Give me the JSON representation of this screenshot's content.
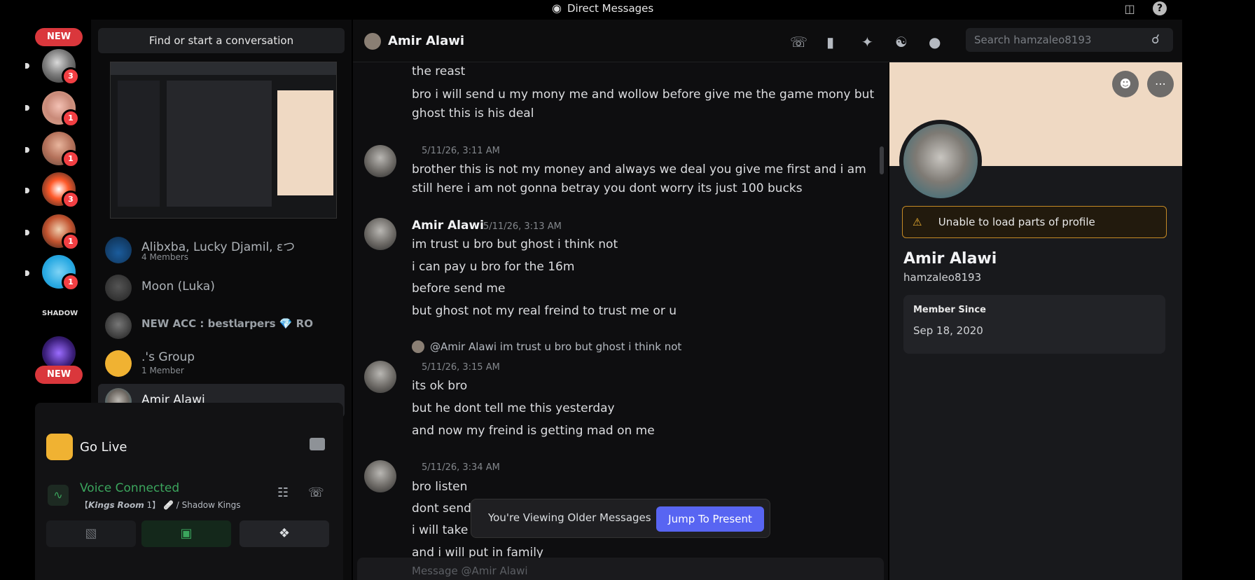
{
  "window": {
    "title": "Direct Messages"
  },
  "rail": {
    "new_top": "NEW",
    "new_bottom": "NEW",
    "badges": [
      "3",
      "1",
      "1",
      "3",
      "1",
      "1"
    ]
  },
  "dm": {
    "search_button": "Find or start a conversation",
    "items": [
      {
        "name": "Alibxba, Lucky Djamil, εつ",
        "sub": "4 Members"
      },
      {
        "name": "Moon (Luka)"
      },
      {
        "name": "𝗡𝗘𝗪 𝗔𝗖𝗖 : 𝗯𝗲𝘀𝘁𝗹𝗮𝗿𝗽𝗲𝗿𝘀 💎 RO"
      },
      {
        "name": ".'s Group",
        "sub": "1 Member"
      },
      {
        "name": "Amir Alawi"
      }
    ]
  },
  "panel": {
    "go_live": "Go Live",
    "voice_status": "Voice Connected",
    "voice_channel": "【𝙆𝙞𝙣𝙜𝙨 𝙍𝙤𝙤𝙢 1】 🩹 / Shadow Kings"
  },
  "chat": {
    "header_name": "Amir Alawi",
    "search_placeholder": "Search hamzaleo8193",
    "messages": {
      "m0": "the reast",
      "m1a": "bro i will send u my mony me and wollow before give me the game mony but",
      "m1b": "ghost this is his deal",
      "t2": "5/11/26, 3:11 AM",
      "m2a": "brother this is not my money and always we deal you give me first and i am",
      "m2b": "still here i am not gonna betray you dont worry its just 100 bucks",
      "a3": "Amir Alawi",
      "t3": "5/11/26, 3:13 AM",
      "m3a": "im trust u bro but ghost i think not",
      "m3b": "i can pay u bro for the 16m",
      "m3c": "before send me",
      "m3d": "but ghost not my real freind to trust me or u",
      "reply": "@Amir Alawi im trust u bro but ghost i think not",
      "t4": "5/11/26, 3:15 AM",
      "m4a": "its ok bro",
      "m4b": "but he dont tell me this yesterday",
      "m4c": "and now my freind is getting mad on me",
      "t5": "5/11/26, 3:34 AM",
      "m5a": "bro listen",
      "m5b": "dont send",
      "m5c": "i will take",
      "m5d": "and i will put in family"
    },
    "toast": {
      "text": "You're Viewing Older Messages",
      "jump": "Jump To Present"
    },
    "composer_placeholder": "Message @Amir Alawi"
  },
  "profile": {
    "warning": "Unable to load parts of profile",
    "name": "Amir Alawi",
    "username": "hamzaleo8193",
    "member_since_label": "Member Since",
    "member_since": "Sep 18, 2020"
  },
  "colors": {
    "accent": "#5865f2",
    "banner": "#efd9c3",
    "warning": "#c58a25",
    "badge": "#f23f43",
    "voice": "#3ba55d"
  }
}
